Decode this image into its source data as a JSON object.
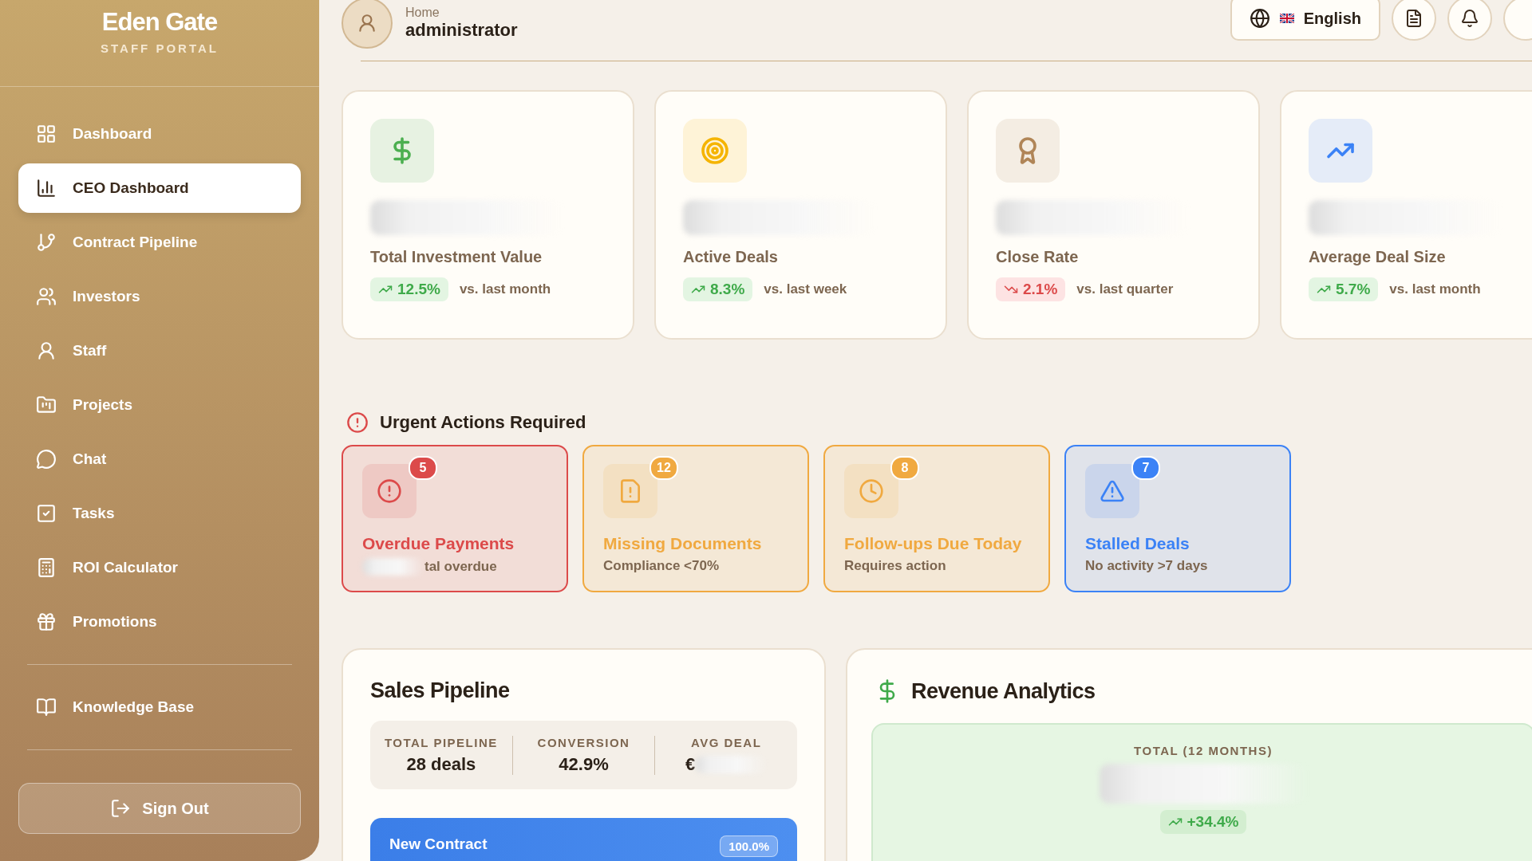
{
  "brand": {
    "title": "Eden Gate",
    "subtitle": "STAFF PORTAL"
  },
  "nav": [
    {
      "label": "Dashboard",
      "selected": false
    },
    {
      "label": "CEO Dashboard",
      "selected": true
    },
    {
      "label": "Contract Pipeline",
      "selected": false
    },
    {
      "label": "Investors",
      "selected": false
    },
    {
      "label": "Staff",
      "selected": false
    },
    {
      "label": "Projects",
      "selected": false
    },
    {
      "label": "Chat",
      "selected": false
    },
    {
      "label": "Tasks",
      "selected": false
    },
    {
      "label": "ROI Calculator",
      "selected": false
    },
    {
      "label": "Promotions",
      "selected": false
    }
  ],
  "nav_secondary": [
    {
      "label": "Knowledge Base",
      "selected": false
    }
  ],
  "sign_out": "Sign Out",
  "header": {
    "breadcrumb": "Home",
    "user": "administrator",
    "language": "English"
  },
  "stats": [
    {
      "color": "#4caf50",
      "label": "Total Investment Value",
      "kind": "up",
      "change": "12.5%",
      "period": "vs. last month"
    },
    {
      "color": "#f5b400",
      "label": "Active Deals",
      "kind": "up",
      "change": "8.3%",
      "period": "vs. last week"
    },
    {
      "color": "#b08557",
      "label": "Close Rate",
      "kind": "down",
      "change": "2.1%",
      "period": "vs. last quarter"
    },
    {
      "color": "#3b82f6",
      "label": "Average Deal Size",
      "kind": "up",
      "change": "5.7%",
      "period": "vs. last month"
    }
  ],
  "urgent": {
    "title": "Urgent Actions Required",
    "items": [
      {
        "color": "#dc4a4a",
        "count": "5",
        "title": "Overdue Payments",
        "detail": "tal overdue"
      },
      {
        "color": "#f0a940",
        "count": "12",
        "title": "Missing Documents",
        "detail": "Compliance <70%"
      },
      {
        "color": "#f0a940",
        "count": "8",
        "title": "Follow-ups Due Today",
        "detail": "Requires action"
      },
      {
        "color": "#3b82f6",
        "count": "7",
        "title": "Stalled Deals",
        "detail": "No activity >7 days"
      }
    ]
  },
  "sales_pipeline": {
    "title": "Sales Pipeline",
    "metrics": [
      {
        "label": "TOTAL PIPELINE",
        "value": "28 deals"
      },
      {
        "label": "CONVERSION",
        "value": "42.9%"
      },
      {
        "label": "AVG DEAL",
        "value": "€"
      }
    ],
    "stage": {
      "name": "New Contract",
      "share": "100.0%"
    }
  },
  "revenue": {
    "title": "Revenue Analytics",
    "total_label": "TOTAL (12 MONTHS)",
    "change": "+34.4%"
  }
}
